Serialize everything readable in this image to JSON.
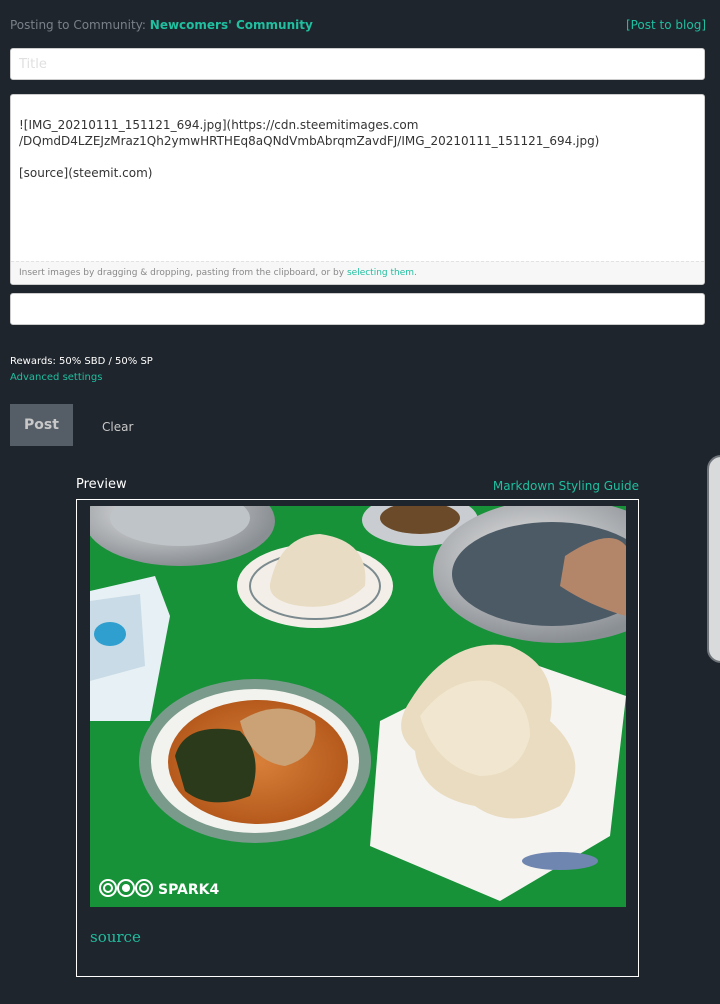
{
  "header": {
    "posting_label": "Posting to Community: ",
    "community_name": "Newcomers' Community",
    "post_to_blog": "[Post to blog]"
  },
  "editor": {
    "title_placeholder": "Title",
    "body_text": "![IMG_20210111_151121_694.jpg](https://cdn.steemitimages.com\n/DQmdD4LZEJzMraz1Qh2ymwHRTHEq8aQNdVmbAbrqmZavdFJ/IMG_20210111_151121_694.jpg)\n\n[source](steemit.com)",
    "dropzone_text": "Insert images by dragging & dropping, pasting from the clipboard, or by ",
    "dropzone_link": "selecting them",
    "dropzone_end": ".",
    "tags_value": ""
  },
  "settings": {
    "rewards": "Rewards: 50% SBD / 50% SP",
    "advanced": "Advanced settings"
  },
  "actions": {
    "post": "Post",
    "clear": "Clear"
  },
  "preview": {
    "label": "Preview",
    "guide": "Markdown Styling Guide",
    "image_watermark": "SPARK4",
    "source_link": "source"
  },
  "colors": {
    "background": "#1f252c",
    "accent": "#1fbfa0",
    "table_green": "#1a9a3e"
  }
}
